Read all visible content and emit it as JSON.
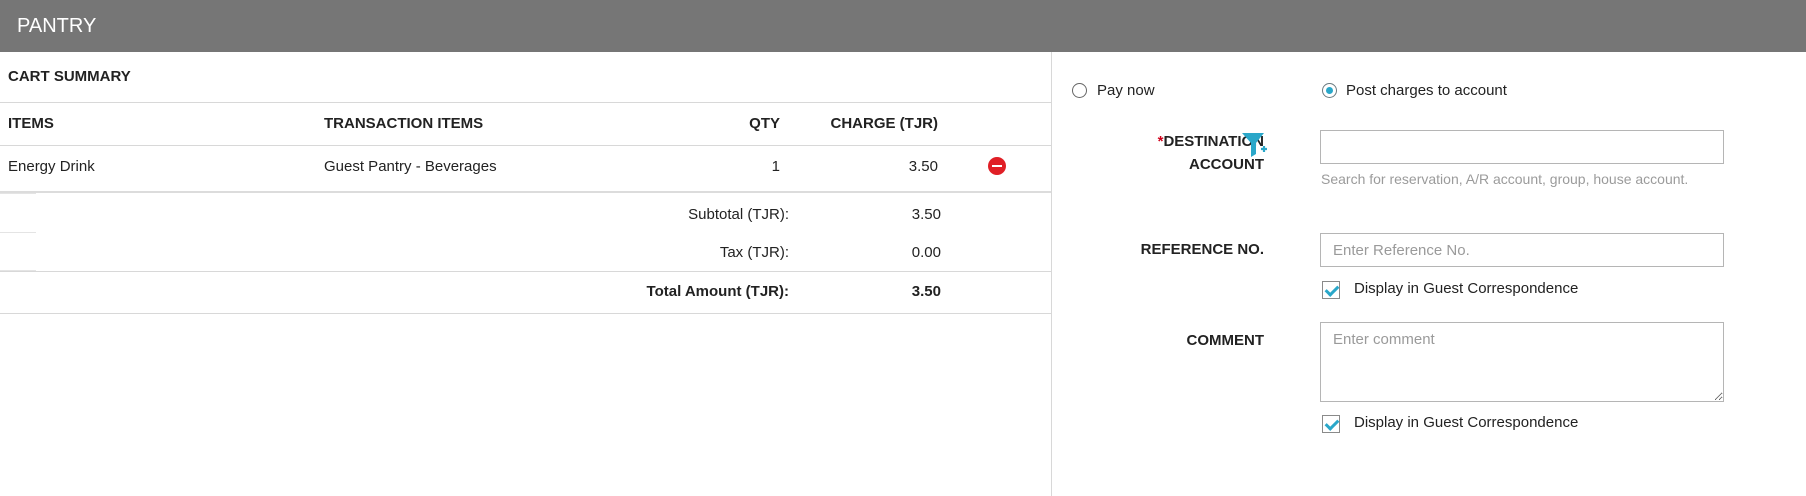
{
  "header": {
    "title": "PANTRY"
  },
  "cart": {
    "title": "CART SUMMARY",
    "columns": {
      "items": "ITEMS",
      "transaction_items": "TRANSACTION ITEMS",
      "qty": "QTY",
      "charge": "CHARGE (TJR)"
    },
    "rows": [
      {
        "item": "Energy Drink",
        "transaction_item": "Guest Pantry - Beverages",
        "qty": "1",
        "charge": "3.50"
      }
    ],
    "subtotal": {
      "label": "Subtotal (TJR):",
      "value": "3.50"
    },
    "tax": {
      "label": "Tax (TJR):",
      "value": "0.00"
    },
    "total": {
      "label": "Total Amount (TJR):",
      "value": "3.50"
    }
  },
  "payment": {
    "options": [
      {
        "label": "Pay now",
        "selected": false
      },
      {
        "label": "Post charges to account",
        "selected": true
      }
    ]
  },
  "form": {
    "destination": {
      "required_mark": "*",
      "label_line1": "DESTINATION",
      "label_line2": "ACCOUNT",
      "value": "",
      "hint": "Search for reservation, A/R account, group, house account."
    },
    "reference": {
      "label": "REFERENCE NO.",
      "placeholder": "Enter Reference No.",
      "value": "",
      "display_label": "Display in Guest Correspondence",
      "display_checked": true
    },
    "comment": {
      "label": "COMMENT",
      "placeholder": "Enter comment",
      "value": "",
      "display_label": "Display in Guest Correspondence",
      "display_checked": true
    }
  },
  "icons": {
    "remove": "remove-circle-icon",
    "filter": "filter-add-icon"
  },
  "colors": {
    "header_bg": "#767676",
    "accent": "#2aa7c9",
    "danger": "#e01f26",
    "required": "#d0021b"
  }
}
